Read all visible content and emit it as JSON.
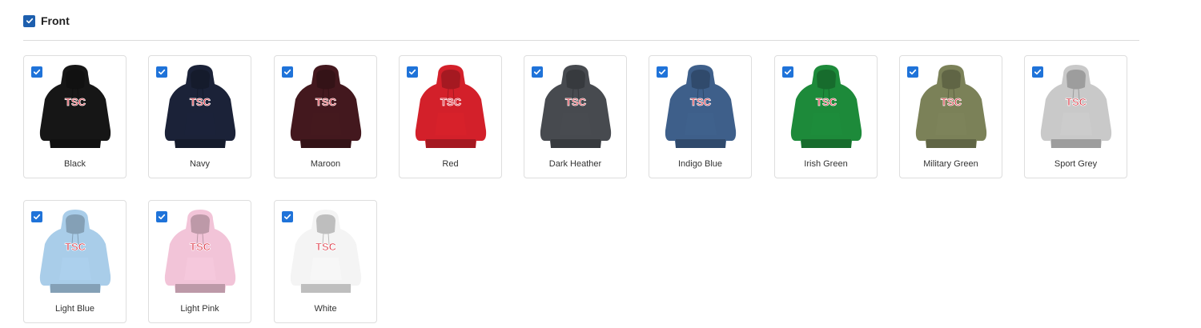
{
  "section": {
    "title": "Front",
    "checked": true
  },
  "variants": [
    {
      "label": "Black",
      "color": "#161616",
      "checked": true
    },
    {
      "label": "Navy",
      "color": "#1b2238",
      "checked": true
    },
    {
      "label": "Maroon",
      "color": "#43181e",
      "checked": true
    },
    {
      "label": "Red",
      "color": "#d3202a",
      "checked": true
    },
    {
      "label": "Dark Heather",
      "color": "#474a4f",
      "checked": true
    },
    {
      "label": "Indigo Blue",
      "color": "#3e5f8a",
      "checked": true
    },
    {
      "label": "Irish Green",
      "color": "#1d8a3a",
      "checked": true
    },
    {
      "label": "Military Green",
      "color": "#7b8158",
      "checked": true
    },
    {
      "label": "Sport Grey",
      "color": "#c9c9c9",
      "checked": true
    },
    {
      "label": "Light Blue",
      "color": "#a9cde9",
      "checked": true
    },
    {
      "label": "Light Pink",
      "color": "#f2c4d8",
      "checked": true
    },
    {
      "label": "White",
      "color": "#f4f4f4",
      "checked": true
    }
  ],
  "logo_text": "TSC",
  "colors": {
    "checkbox": "#1f73d9",
    "logo_red": "#d8202f",
    "logo_blue": "#2a3d8f"
  }
}
